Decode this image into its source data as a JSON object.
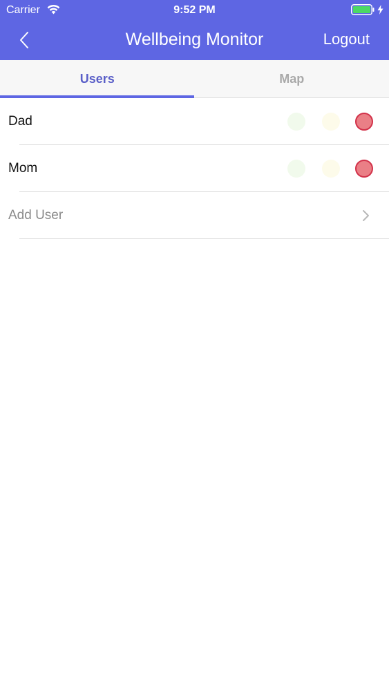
{
  "status_bar": {
    "carrier": "Carrier",
    "time": "9:52 PM",
    "wifi_icon": "wifi-icon",
    "battery_icon": "battery-icon",
    "charging_icon": "charging-bolt-icon"
  },
  "nav": {
    "back_icon": "chevron-left-icon",
    "title": "Wellbeing Monitor",
    "logout_label": "Logout"
  },
  "tabs": [
    {
      "label": "Users",
      "active": true
    },
    {
      "label": "Map",
      "active": false
    }
  ],
  "users": [
    {
      "name": "Dad",
      "status": {
        "green": false,
        "yellow": false,
        "red": true
      }
    },
    {
      "name": "Mom",
      "status": {
        "green": false,
        "yellow": false,
        "red": true
      }
    }
  ],
  "add_user": {
    "label": "Add User",
    "icon": "chevron-right-icon"
  },
  "colors": {
    "header": "#5e66e3",
    "tab_active": "#5a5fc8",
    "tab_inactive": "#a9a9a9",
    "status_green_off": "#f1faec",
    "status_yellow_off": "#fdfbea",
    "status_red_on": "#ea7f86",
    "status_red_border": "#d2324a"
  }
}
